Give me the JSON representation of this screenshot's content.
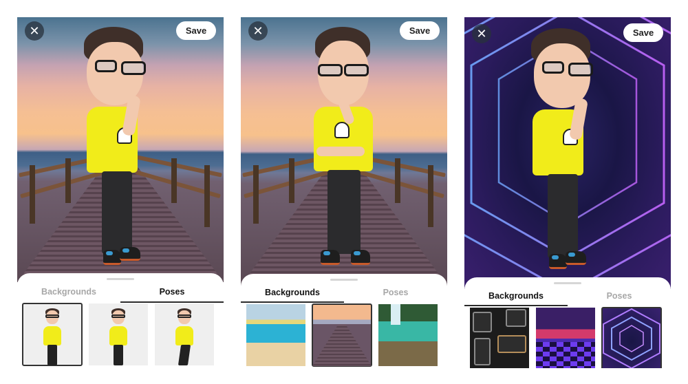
{
  "screens": [
    {
      "id": "screen-1",
      "background": "sunset-pier",
      "pose": "namaste",
      "top_bar": {
        "close_icon": "close-icon",
        "close_glyph": "✕",
        "save_label": "Save"
      },
      "tabs": [
        {
          "label": "Backgrounds",
          "active": false
        },
        {
          "label": "Poses",
          "active": true
        }
      ],
      "thumbnails": [
        {
          "name": "pose-thinking",
          "selected": true
        },
        {
          "name": "pose-arms-crossed",
          "selected": false
        },
        {
          "name": "pose-side-walk",
          "selected": false
        }
      ]
    },
    {
      "id": "screen-2",
      "background": "sunset-pier",
      "pose": "thinking",
      "top_bar": {
        "close_icon": "close-icon",
        "close_glyph": "✕",
        "save_label": "Save"
      },
      "tabs": [
        {
          "label": "Backgrounds",
          "active": true
        },
        {
          "label": "Poses",
          "active": false
        }
      ],
      "thumbnails": [
        {
          "name": "bg-pool-palms",
          "selected": false
        },
        {
          "name": "bg-sunset-pier",
          "selected": true
        },
        {
          "name": "bg-waterfall",
          "selected": false
        }
      ]
    },
    {
      "id": "screen-3",
      "background": "neon-hexagon-tunnel",
      "pose": "namaste",
      "top_bar": {
        "close_icon": "close-icon",
        "close_glyph": "✕",
        "save_label": "Save"
      },
      "tabs": [
        {
          "label": "Backgrounds",
          "active": true
        },
        {
          "label": "Poses",
          "active": false
        }
      ],
      "thumbnails": [
        {
          "name": "bg-speaker-wall",
          "selected": false
        },
        {
          "name": "bg-neon-club",
          "selected": false
        },
        {
          "name": "bg-neon-hexagon-tunnel",
          "selected": true
        }
      ]
    }
  ],
  "colors": {
    "shirt": "#f1ec1a",
    "pants": "#2b2b2d",
    "active_tab_text": "#111111",
    "inactive_tab_text": "#a7a7a7",
    "save_button_bg": "#ffffff",
    "close_button_bg": "#28323c"
  }
}
